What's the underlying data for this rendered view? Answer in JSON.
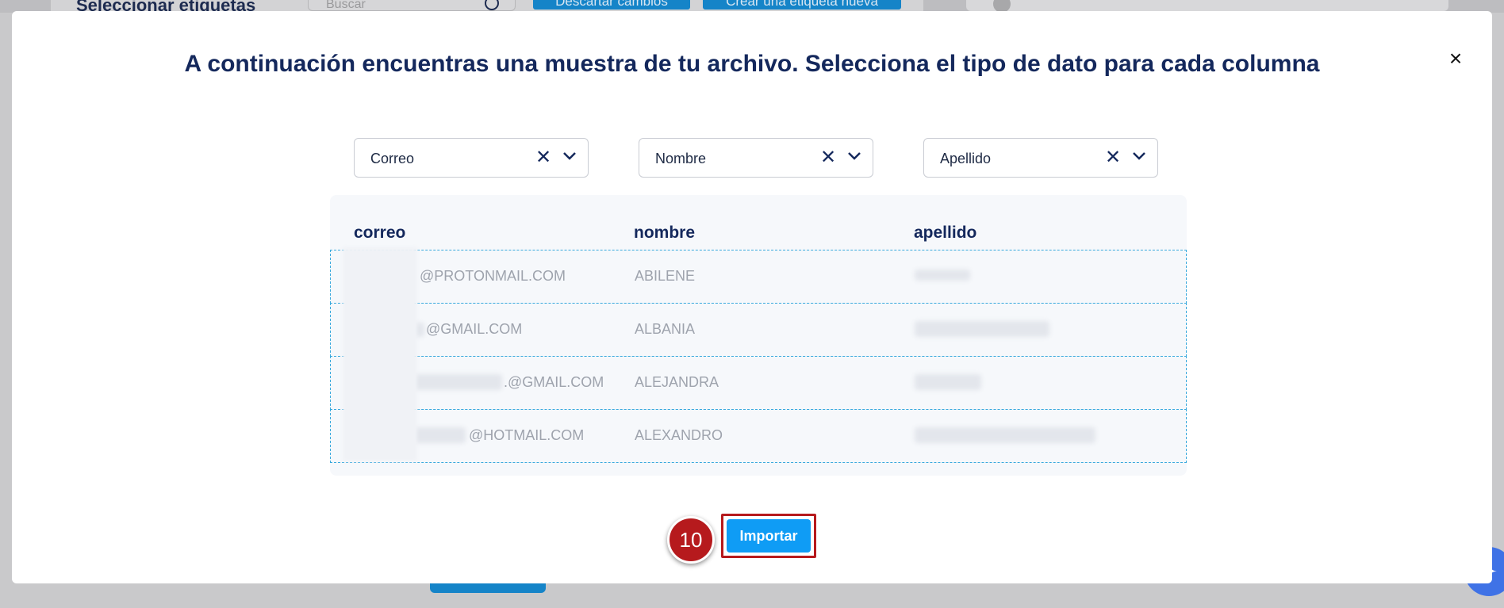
{
  "background": {
    "panel_title": "Seleccionar etiquetas",
    "search_placeholder": "Buscar",
    "discard_label": "Descartar cambios",
    "create_label": "Crear una etiqueta nueva",
    "fab_icon": "sparkle-icon"
  },
  "modal": {
    "title": "A continuación encuentras una muestra de tu archivo. Selecciona el tipo de dato para cada columna",
    "close_icon": "close-icon",
    "selects": [
      {
        "value": "Correo"
      },
      {
        "value": "Nombre"
      },
      {
        "value": "Apellido"
      }
    ],
    "table": {
      "headers": [
        "correo",
        "nombre",
        "apellido"
      ],
      "rows": [
        {
          "correo": "@PROTONMAIL.COM",
          "nombre": "ABILENE"
        },
        {
          "correo": "@GMAIL.COM",
          "nombre": "ALBANIA"
        },
        {
          "correo": ".@GMAIL.COM",
          "nombre": "ALEJANDRA"
        },
        {
          "correo": "@HOTMAIL.COM",
          "nombre": "ALEXANDRO"
        }
      ]
    },
    "step_number": "10",
    "import_label": "Importar"
  },
  "colors": {
    "title": "#14285c",
    "primary_button": "#0f9cf5",
    "highlight": "#b61a1d",
    "row_border": "#39a9dd"
  }
}
